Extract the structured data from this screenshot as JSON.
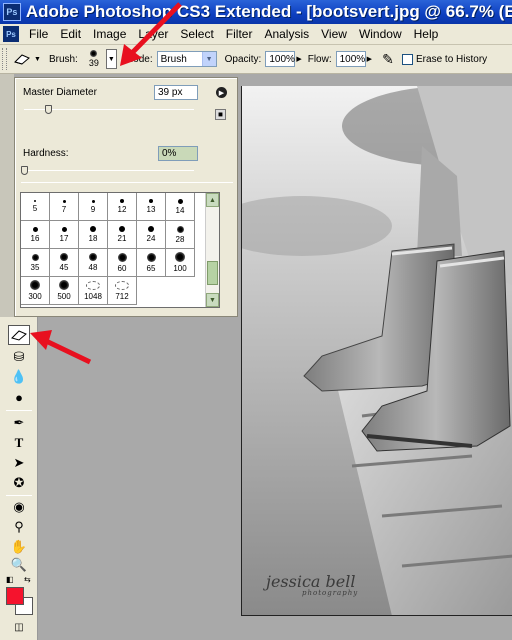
{
  "window": {
    "app_icon": "Ps",
    "title": "Adobe Photoshop CS3 Extended - [bootsvert.jpg @ 66.7% (E"
  },
  "menu": {
    "items": [
      "File",
      "Edit",
      "Image",
      "Layer",
      "Select",
      "Filter",
      "Analysis",
      "View",
      "Window",
      "Help"
    ]
  },
  "options": {
    "brush_label": "Brush:",
    "brush_size": "39",
    "mode_label": "Mode:",
    "mode_value": "Brush",
    "opacity_label": "Opacity:",
    "opacity_value": "100%",
    "flow_label": "Flow:",
    "flow_value": "100%",
    "erase_history_label": "Erase to History"
  },
  "brush_panel": {
    "master_diameter_label": "Master Diameter",
    "master_diameter_value": "39 px",
    "master_diameter_level": 0.14,
    "hardness_label": "Hardness:",
    "hardness_value": "0%",
    "hardness_level": 0.0,
    "presets": [
      {
        "size": "5",
        "dot": 2
      },
      {
        "size": "7",
        "dot": 3
      },
      {
        "size": "9",
        "dot": 3
      },
      {
        "size": "12",
        "dot": 4
      },
      {
        "size": "13",
        "dot": 4
      },
      {
        "size": "14",
        "dot": 5
      },
      {
        "size": "16",
        "dot": 5
      },
      {
        "size": "17",
        "dot": 5
      },
      {
        "size": "18",
        "dot": 6
      },
      {
        "size": "21",
        "dot": 6
      },
      {
        "size": "24",
        "dot": 6
      },
      {
        "size": "28",
        "dot": 7
      },
      {
        "size": "35",
        "dot": 7
      },
      {
        "size": "45",
        "dot": 8
      },
      {
        "size": "48",
        "dot": 8
      },
      {
        "size": "60",
        "dot": 9
      },
      {
        "size": "65",
        "dot": 9
      },
      {
        "size": "100",
        "dot": 10
      },
      {
        "size": "300",
        "dot": 10
      },
      {
        "size": "500",
        "dot": 10
      },
      {
        "size": "1048",
        "dot": 0
      },
      {
        "size": "712",
        "dot": 0
      }
    ]
  },
  "watermark": {
    "name": "jessica bell",
    "sub": "photography"
  },
  "colors": {
    "title_bar": "#0d3fc0",
    "foreground": "#f5132d",
    "background": "#ffffff",
    "annotation": "#e8101f"
  }
}
